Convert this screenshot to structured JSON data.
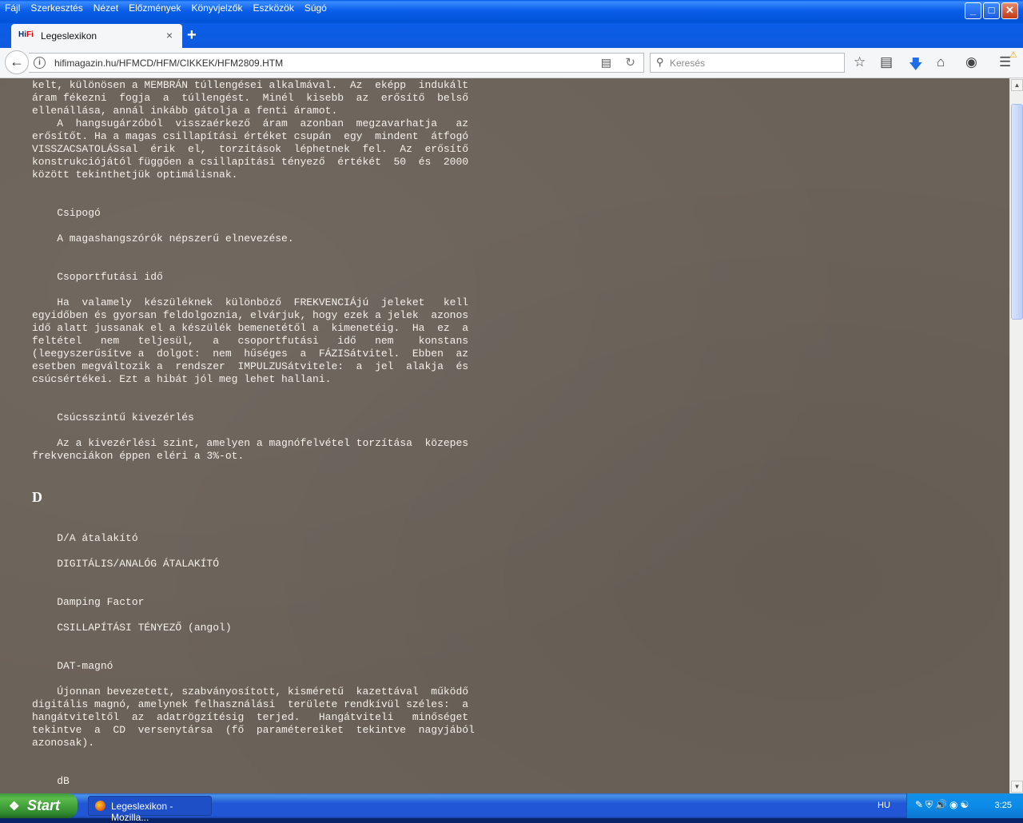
{
  "menubar": {
    "items": [
      "Fájl",
      "Szerkesztés",
      "Nézet",
      "Előzmények",
      "Könyvjelzők",
      "Eszközök",
      "Súgó"
    ],
    "minimize": "_",
    "maximize": "□",
    "close": "✕"
  },
  "tab": {
    "favicon_hi": "Hi",
    "favicon_fi": "Fi",
    "title": "Legeslexikon",
    "close": "×",
    "new_tab": "+"
  },
  "nav": {
    "url": "hifimagazin.hu/HFMCD/HFM/CIKKEK/HFM2809.HTM",
    "search_placeholder": "Keresés"
  },
  "content": {
    "block1": "kelt, különösen a MEMBRÁN túllengései alkalmával.  Az  eképp  indukált\náram fékezni  fogja  a  túllengést.  Minél  kisebb  az  erősítő  belső\nellenállása, annál inkább gátolja a fenti áramot.\n    A  hangsugárzóból  visszaérkező  áram  azonban  megzavarhatja   az\nerősítőt. Ha a magas csillapítási értéket csupán  egy  mindent  átfogó\nVISSZACSATOLÁSsal  érik  el,  torzítások  léphetnek  fel.  Az  erősítő\nkonstrukciójától függően a csillapítási tényező  értékét  50  és  2000\nközött tekinthetjük optimálisnak.",
    "block2": "    Csipogó\n\n    A magashangszórók népszerű elnevezése.\n\n\n    Csoportfutási idő\n\n    Ha  valamely  készüléknek  különböző  FREKVENCIÁjú  jeleket   kell\negyidőben és gyorsan feldolgoznia, elvárjuk, hogy ezek a jelek  azonos\nidő alatt jussanak el a készülék bemenetétől a  kimenetéig.  Ha  ez  a\nfeltétel   nem   teljesül,   a   csoportfutási   idő   nem    konstans\n(leegyszerűsítve a  dolgot:  nem  hűséges  a  FÁZISátvitel.  Ebben  az\nesetben megváltozik a  rendszer  IMPULZUSátvitele:  a  jel  alakja  és\ncsúcsértékei. Ezt a hibát jól meg lehet hallani.\n\n\n    Csúcsszintű kivezérlés\n\n    Az a kivezérlési szint, amelyen a magnófelvétel torzítása  közepes\nfrekvenciákon éppen eléri a 3%-ot.",
    "letter": "D",
    "block3": "    D/A átalakító\n\n    DIGITÁLIS/ANALÓG ÁTALAKÍTÓ\n\n\n    Damping Factor\n\n    CSILLAPÍTÁSI TÉNYEZŐ (angol)\n\n\n    DAT-magnó\n\n    Újonnan bevezetett, szabványosított, kisméretű  kazettával  működő\ndigitális magnó, amelynek felhasználási  területe rendkívül széles:  a\nhangátviteltől  az  adatrögzítésig  terjed.   Hangátviteli   minőséget\ntekintve  a  CD  versenytársa  (fő  paramétereiket  tekintve  nagyjából\nazonosak).\n\n\n    dB"
  },
  "taskbar": {
    "start": "Start",
    "task_title": "Legeslexikon - Mozilla...",
    "lang": "HU",
    "clock": "3:25"
  }
}
